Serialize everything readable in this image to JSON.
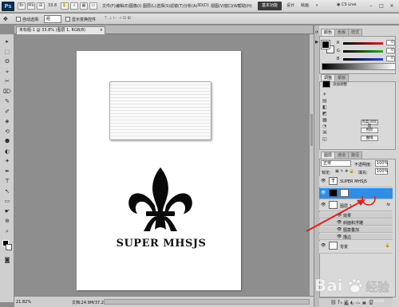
{
  "menubar": {
    "logo": "Ps",
    "zoom": "33.8",
    "menus": [
      "文件(F)",
      "编辑(E)",
      "图像(I)",
      "图层(L)",
      "选择(S)",
      "滤镜(T)",
      "分析(A)",
      "3D(D)",
      "视图(V)",
      "窗口(W)",
      "帮助(H)"
    ],
    "workspaces": [
      "基本功能",
      "设计",
      "绘画",
      "»"
    ],
    "cslive": "CS Live",
    "window_buttons": [
      "–",
      "□",
      "×"
    ]
  },
  "options": {
    "auto_select_label": "自动选择:",
    "auto_select_value": "组",
    "show_transform": "显示变换控件"
  },
  "document": {
    "tab_title": "未标题-1 @ 33.8% (图层 1, RGB/8)",
    "tab_close": "×",
    "logo_text": "SUPER MHSJS",
    "zoom": "21.82%",
    "doc_info": "文档:24.9M/37.28M"
  },
  "tools": [
    "▸",
    "⬚",
    "ʘ",
    "⌖",
    "✂",
    "⌦",
    "✎",
    "✐",
    "◈",
    "⟲",
    "⬣",
    "◐",
    "✦",
    "✒",
    "T",
    "↖",
    "▭",
    "☛",
    "⊕",
    "⌕"
  ],
  "color_panel": {
    "tabs": [
      "颜色",
      "色板",
      "样式"
    ],
    "channels": [
      {
        "label": "R",
        "value": "0",
        "color": "#e02020"
      },
      {
        "label": "G",
        "value": "0",
        "color": "#20b020"
      },
      {
        "label": "B",
        "value": "0",
        "color": "#2040e0"
      }
    ]
  },
  "adjust_panel": {
    "tabs": [
      "调整",
      "蒙版"
    ],
    "title": "添加调整",
    "buttons": [
      "亮度/对比度",
      "色阶",
      "曲线"
    ]
  },
  "layers_panel": {
    "tabs": [
      "图层",
      "通道",
      "路径"
    ],
    "blend_mode": "正常",
    "opacity_label": "不透明度:",
    "opacity": "100%",
    "lock_label": "锁定:",
    "fill_label": "填充:",
    "fill": "100%",
    "layers": [
      {
        "name": "SUPER MHSJS",
        "type": "text",
        "selected": false
      },
      {
        "name": "",
        "type": "shape",
        "selected": true
      },
      {
        "name": "图层 1",
        "type": "image",
        "selected": false,
        "fx": "fx"
      },
      {
        "name": "效果",
        "type": "effect-group",
        "selected": false
      },
      {
        "name": "斜面和浮雕",
        "type": "effect",
        "selected": false
      },
      {
        "name": "图案叠加",
        "type": "effect",
        "selected": false
      },
      {
        "name": "描边",
        "type": "effect",
        "selected": false
      },
      {
        "name": "背景",
        "type": "background",
        "selected": false
      }
    ]
  },
  "watermark": {
    "brand": "Bai",
    "brand_tail": "经验",
    "url": "jingyan.baidu.com"
  },
  "colors": {
    "selection": "#2f8de6",
    "annotation": "#e02020"
  }
}
